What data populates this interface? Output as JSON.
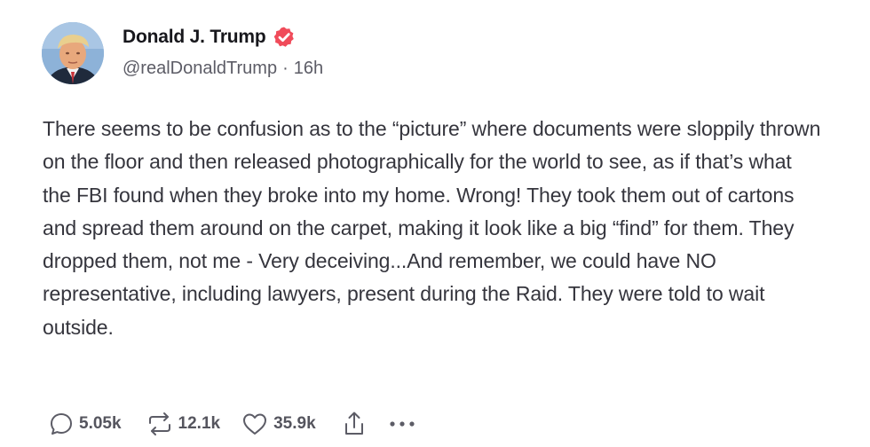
{
  "post": {
    "author": {
      "display_name": "Donald J. Trump",
      "handle": "@realDonaldTrump",
      "verified": true,
      "verified_color": "#f04b5a"
    },
    "separator": "·",
    "time_ago": "16h",
    "text": "There seems to be confusion as to the “picture” where documents were sloppily thrown on the floor and then released photographically for the world to see, as if that’s what the FBI found when they broke into my home. Wrong! They took them out of cartons and spread them around on the carpet, making it look like a big “find” for them. They dropped them, not me - Very deceiving...And remember, we could have NO representative, including lawyers, present during the Raid. They were told to wait outside.",
    "actions": {
      "replies": "5.05k",
      "retruths": "12.1k",
      "likes": "35.9k",
      "share_icon": "share-icon",
      "more_icon": "more-icon"
    }
  }
}
